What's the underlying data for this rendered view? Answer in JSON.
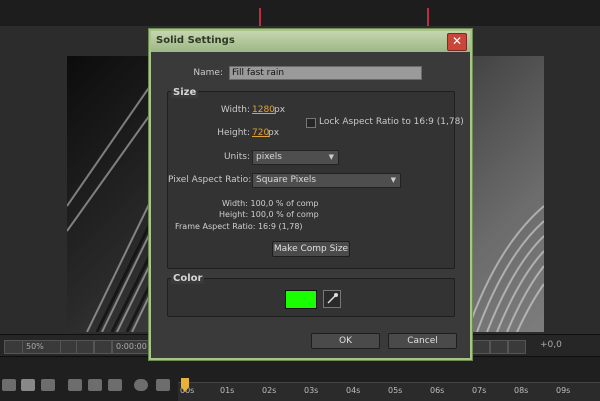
{
  "dialog": {
    "title": "Solid Settings",
    "close_glyph": "✕",
    "name_label": "Name:",
    "name_value": "Fill fast rain",
    "size": {
      "title": "Size",
      "width_label": "Width:",
      "width_value": "1280",
      "width_unit": "px",
      "height_label": "Height:",
      "height_value": "720",
      "height_unit": "px",
      "lock_label": "Lock Aspect Ratio to 16:9 (1,78)",
      "units_label": "Units:",
      "units_value": "pixels",
      "par_label": "Pixel Aspect Ratio:",
      "par_value": "Square Pixels",
      "info_width": "Width: 100,0 % of comp",
      "info_height": "Height: 100,0 % of comp",
      "info_far": "Frame Aspect Ratio: 16:9 (1,78)",
      "make_comp_size": "Make Comp Size"
    },
    "color": {
      "title": "Color",
      "swatch": "#1aff00",
      "eyedropper_icon": "eyedropper-icon"
    },
    "ok": "OK",
    "cancel": "Cancel"
  },
  "viewer": {
    "zoom": "50%",
    "timecode": "0:00:00",
    "exposure": "+0,0"
  },
  "timeline": {
    "ticks": [
      "00s",
      "01s",
      "02s",
      "03s",
      "04s",
      "05s",
      "06s",
      "07s",
      "08s",
      "09s"
    ]
  }
}
